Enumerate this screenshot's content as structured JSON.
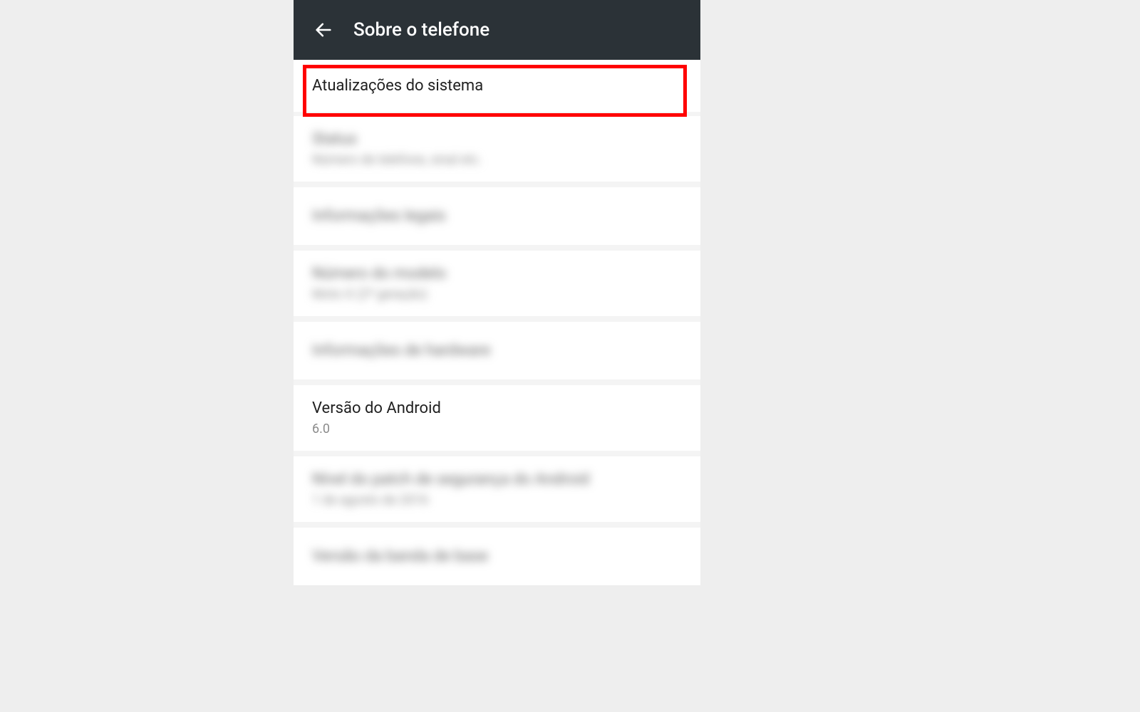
{
  "header": {
    "title": "Sobre o telefone"
  },
  "items": [
    {
      "title": "Atualizações do sistema",
      "sub": "",
      "blurred": false,
      "highlighted": true
    },
    {
      "title": "Status",
      "sub": "Número de telefone, sinal etc.",
      "blurred": true,
      "highlighted": false
    },
    {
      "title": "Informações legais",
      "sub": "",
      "blurred": true,
      "highlighted": false
    },
    {
      "title": "Número do modelo",
      "sub": "Moto X (2ª geração)",
      "blurred": true,
      "highlighted": false
    },
    {
      "title": "Informações de hardware",
      "sub": "",
      "blurred": true,
      "highlighted": false
    },
    {
      "title": "Versão do Android",
      "sub": "6.0",
      "blurred": false,
      "highlighted": false
    },
    {
      "title": "Nível do patch de segurança do Android",
      "sub": "1 de agosto de 2016",
      "blurred": true,
      "highlighted": false
    },
    {
      "title": "Versão da banda de base",
      "sub": "",
      "blurred": true,
      "highlighted": false
    }
  ],
  "colors": {
    "highlight": "#ff0000",
    "appbar": "#2b3237"
  }
}
